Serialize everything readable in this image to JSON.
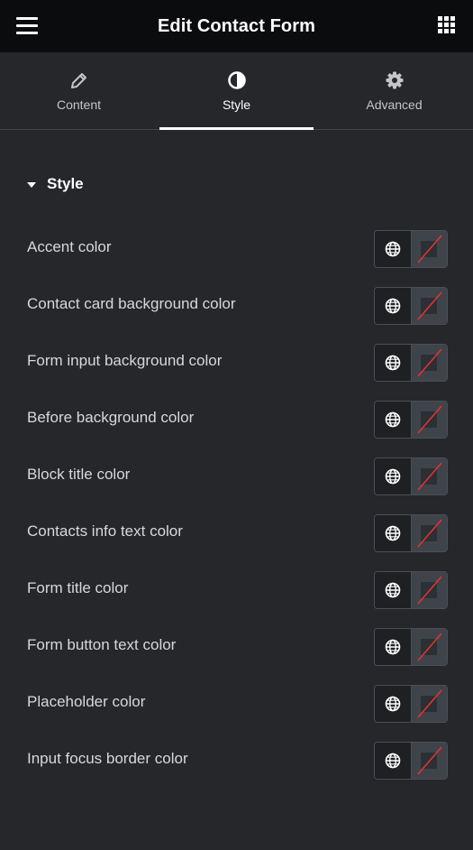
{
  "header": {
    "title": "Edit Contact Form",
    "menu_icon": "hamburger-icon",
    "apps_icon": "grid-icon"
  },
  "tabs": [
    {
      "label": "Content",
      "icon": "pencil-icon",
      "active": false
    },
    {
      "label": "Style",
      "icon": "half-circle-icon",
      "active": true
    },
    {
      "label": "Advanced",
      "icon": "gear-icon",
      "active": false
    }
  ],
  "section": {
    "title": "Style",
    "expanded": true
  },
  "controls": [
    {
      "label": "Accent color"
    },
    {
      "label": "Contact card background color"
    },
    {
      "label": "Form input background color"
    },
    {
      "label": "Before background color"
    },
    {
      "label": "Block title color"
    },
    {
      "label": "Contacts info text color"
    },
    {
      "label": "Form title color"
    },
    {
      "label": "Form button text color"
    },
    {
      "label": "Placeholder color"
    },
    {
      "label": "Input focus border color"
    }
  ],
  "colors": {
    "header_bg": "#0b0c0e",
    "panel_bg": "#26272b",
    "swatch_empty": "#3f444b",
    "no_color_slash": "#e0342f"
  }
}
